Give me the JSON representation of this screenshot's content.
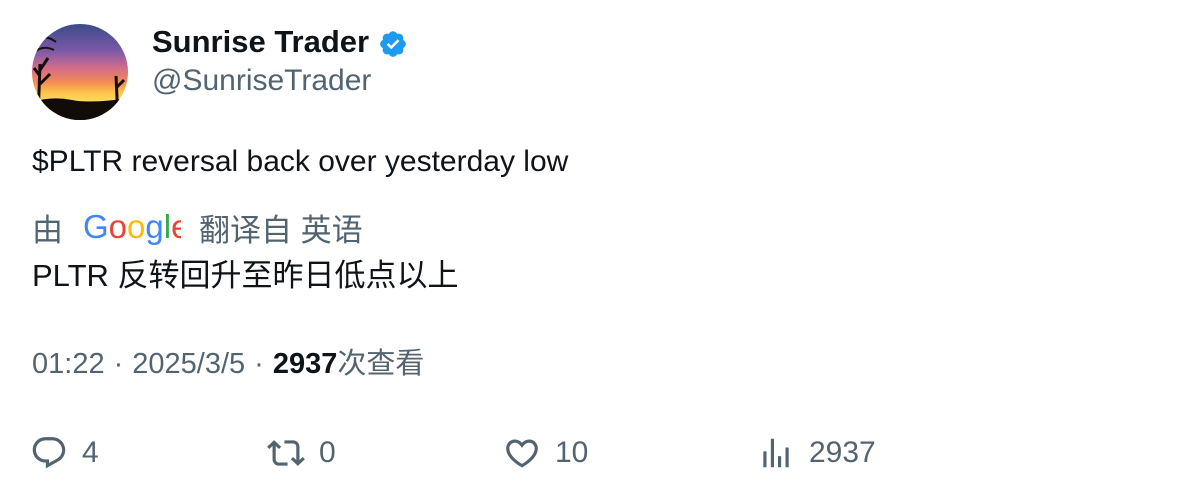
{
  "user": {
    "display_name": "Sunrise Trader",
    "handle": "@SunriseTrader",
    "verified_color": "#1d9bf0"
  },
  "tweet": {
    "text": "$PLTR reversal back over yesterday low"
  },
  "translation": {
    "by_label": "由",
    "provider": "Google",
    "translated_from_label": "翻译自 英语",
    "translated_text": "PLTR 反转回升至昨日低点以上"
  },
  "meta": {
    "time": "01:22",
    "separator": "·",
    "date": "2025/3/5",
    "views_count": "2937",
    "views_label": "次查看"
  },
  "actions": {
    "reply": {
      "icon": "reply-icon",
      "count": "4"
    },
    "retweet": {
      "icon": "retweet-icon",
      "count": "0"
    },
    "like": {
      "icon": "heart-icon",
      "count": "10"
    },
    "views": {
      "icon": "analytics-icon",
      "count": "2937"
    }
  },
  "colors": {
    "text_primary": "#0f1419",
    "text_secondary": "#536471",
    "accent": "#1d9bf0"
  }
}
